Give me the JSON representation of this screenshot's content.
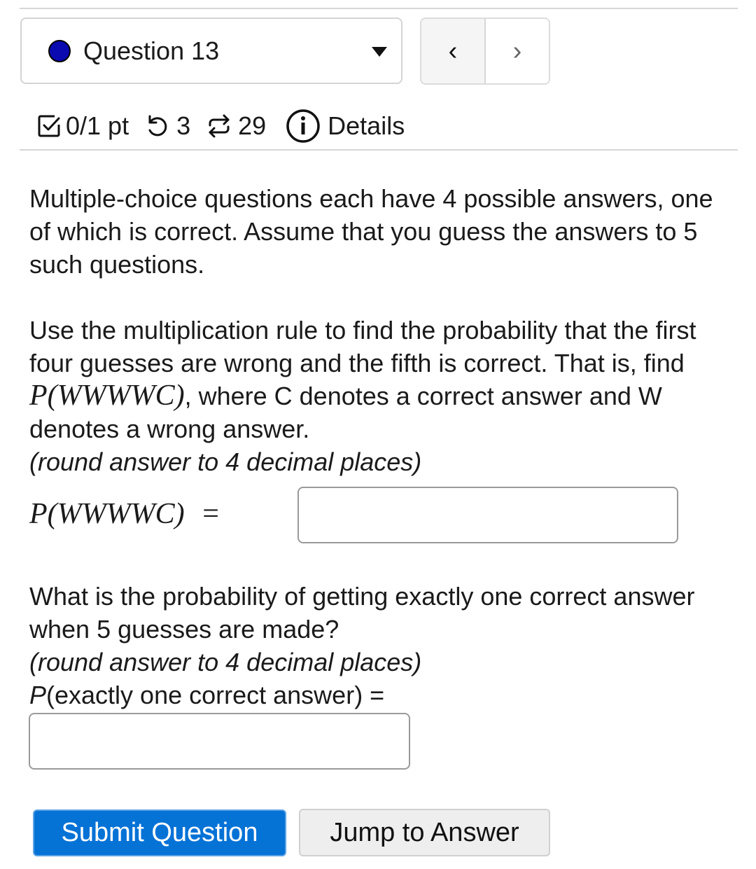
{
  "header": {
    "question_selector": {
      "label": "Question 13",
      "status_color": "#0a0ab0"
    },
    "nav": {
      "prev_glyph": "‹",
      "next_glyph": "›"
    }
  },
  "meta": {
    "score": "0/1 pt",
    "retries": "3",
    "attempts": "29",
    "details_label": "Details"
  },
  "question": {
    "intro": "Multiple-choice questions each have 4 possible answers, one of which is correct. Assume that you guess the answers to 5 such questions.",
    "part1_text_a": "Use the multiplication rule to find the probability that the first four guesses are wrong and the fifth is correct. That is, find ",
    "part1_math": "P(WWWWC)",
    "part1_text_b": ", where C denotes a correct answer and W denotes a wrong answer.",
    "part1_round": "(round answer to 4 decimal places)",
    "part1_label_math": "P(WWWWC)",
    "part1_equals": "=",
    "part1_answer": "",
    "part2_text": "What is the probability of getting exactly one correct answer when 5 guesses are made?",
    "part2_round": "(round answer to 4 decimal places)",
    "part2_label_p": "P",
    "part2_label_rest": "(exactly one correct answer) =",
    "part2_answer": ""
  },
  "buttons": {
    "submit": "Submit Question",
    "jump": "Jump to Answer"
  },
  "colors": {
    "primary": "#0572d6"
  }
}
